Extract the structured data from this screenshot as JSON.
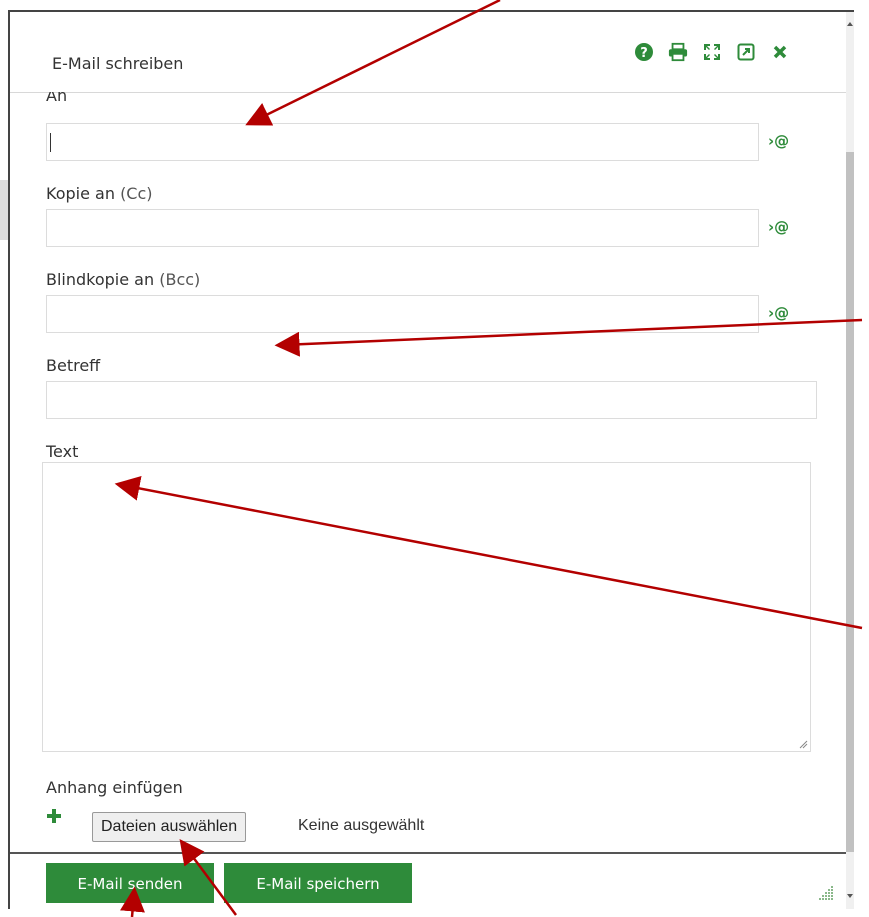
{
  "dialog": {
    "title": "E-Mail schreiben",
    "title_icons": [
      "help-icon",
      "print-icon",
      "fullscreen-icon",
      "popout-icon",
      "close-icon"
    ]
  },
  "form": {
    "to": {
      "label": "An",
      "value": "",
      "picker": "›@"
    },
    "cc": {
      "label": "Kopie an",
      "label_sub": "(Cc)",
      "value": "",
      "picker": "›@"
    },
    "bcc": {
      "label": "Blindkopie an",
      "label_sub": "(Bcc)",
      "value": "",
      "picker": "›@"
    },
    "subject": {
      "label": "Betreff",
      "value": ""
    },
    "body": {
      "label": "Text",
      "value": ""
    },
    "attachment": {
      "label": "Anhang einfügen",
      "choose_button": "Dateien auswählen",
      "status": "Keine ausgewählt"
    }
  },
  "footer": {
    "send_label": "E-Mail senden",
    "save_label": "E-Mail speichern"
  },
  "colors": {
    "accent": "#2e8b3a",
    "annotation": "#b30000"
  }
}
